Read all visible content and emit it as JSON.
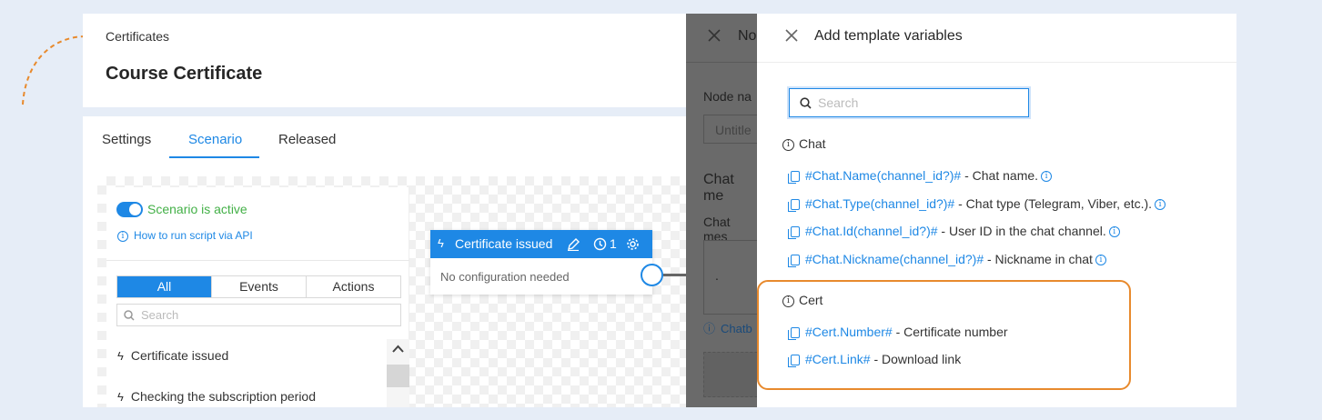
{
  "breadcrumb": "Certificates",
  "page_title": "Course Certificate",
  "tabs": [
    {
      "label": "Settings",
      "active": false
    },
    {
      "label": "Scenario",
      "active": true
    },
    {
      "label": "Released",
      "active": false
    }
  ],
  "scenario": {
    "active_label": "Scenario is active",
    "api_link": "How to run script via API",
    "filters": [
      "All",
      "Events",
      "Actions"
    ],
    "search_placeholder": "Search",
    "items": [
      "Certificate issued",
      "Checking the subscription period"
    ]
  },
  "node": {
    "title": "Certificate issued",
    "count": "1",
    "body": "No configuration needed"
  },
  "back_drawer": {
    "title_partial": "No",
    "field_label_partial": "Node na",
    "field_placeholder_partial": "Untitle",
    "chat_heading_partial": "Chat me",
    "chat_label_partial": "Chat mes",
    "textarea_value": ".",
    "link_partial": "Chatb"
  },
  "drawer": {
    "title": "Add template variables",
    "search_placeholder": "Search",
    "sections": [
      {
        "title": "Chat",
        "vars": [
          {
            "code": "#Chat.Name(channel_id?)#",
            "desc": " - Chat name.",
            "info": true
          },
          {
            "code": "#Chat.Type(channel_id?)#",
            "desc": " - Chat type (Telegram, Viber, etc.).",
            "info": true
          },
          {
            "code": "#Chat.Id(channel_id?)#",
            "desc": " - User ID in the chat channel.",
            "info": true
          },
          {
            "code": "#Chat.Nickname(channel_id?)#",
            "desc": " - Nickname in chat",
            "info": true
          }
        ]
      },
      {
        "title": "Cert",
        "vars": [
          {
            "code": "#Cert.Number#",
            "desc": " - Certificate number",
            "info": false
          },
          {
            "code": "#Cert.Link#",
            "desc": " - Download link",
            "info": false
          }
        ]
      }
    ]
  },
  "colors": {
    "accent": "#1e88e5",
    "highlight": "#e88a2d",
    "active_green": "#43b047",
    "background": "#e6edf7"
  }
}
